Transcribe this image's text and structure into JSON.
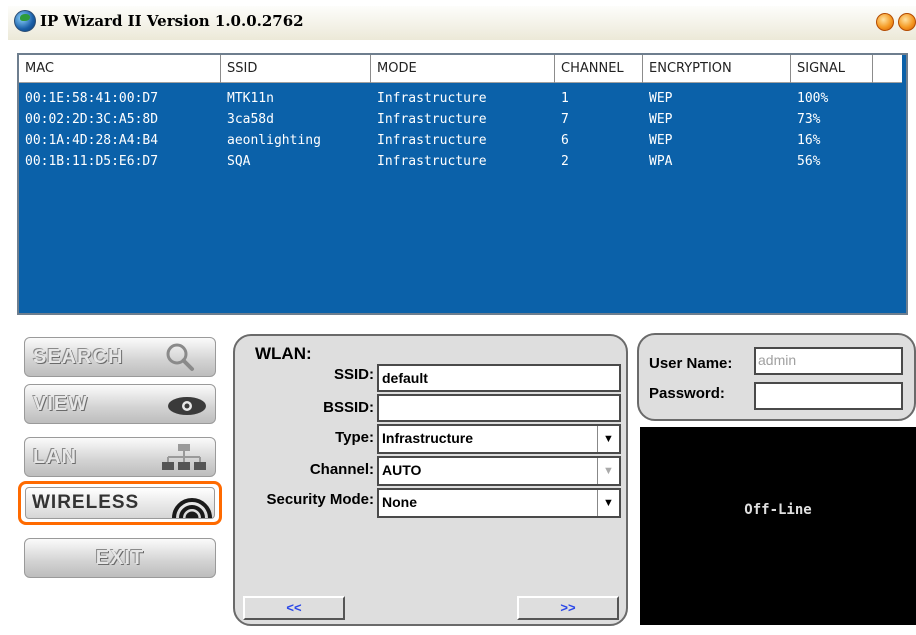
{
  "window": {
    "title": "IP Wizard II  Version 1.0.0.2762"
  },
  "device_list": {
    "columns": [
      "MAC",
      "SSID",
      "MODE",
      "CHANNEL",
      "ENCRYPTION",
      "SIGNAL"
    ],
    "rows": [
      [
        "00:1E:58:41:00:D7",
        "MTK11n",
        "Infrastructure",
        "1",
        "WEP",
        "100%"
      ],
      [
        "00:02:2D:3C:A5:8D",
        "3ca58d",
        "Infrastructure",
        "7",
        "WEP",
        "73%"
      ],
      [
        "00:1A:4D:28:A4:B4",
        "aeonlighting",
        "Infrastructure",
        "6",
        "WEP",
        "16%"
      ],
      [
        "00:1B:11:D5:E6:D7",
        "SQA",
        "Infrastructure",
        "2",
        "WPA",
        "56%"
      ]
    ]
  },
  "nav": {
    "search": "SEARCH",
    "view": "VIEW",
    "lan": "LAN",
    "wireless": "WIRELESS",
    "exit": "EXIT"
  },
  "wlan": {
    "heading": "WLAN:",
    "ssid_label": "SSID:",
    "ssid_value": "default",
    "bssid_label": "BSSID:",
    "bssid_value": "",
    "type_label": "Type:",
    "type_value": "Infrastructure",
    "channel_label": "Channel:",
    "channel_value": "AUTO",
    "security_label": "Security Mode:",
    "security_value": "None",
    "prev_label": "<<",
    "next_label": ">>"
  },
  "login": {
    "username_label": "User Name:",
    "username_value": "admin",
    "password_label": "Password:",
    "password_value": ""
  },
  "status": {
    "text": "Off-Line"
  },
  "colors": {
    "list_background": "#0b61a9",
    "selected_outline": "#ff6a00",
    "status_background": "#000000"
  }
}
